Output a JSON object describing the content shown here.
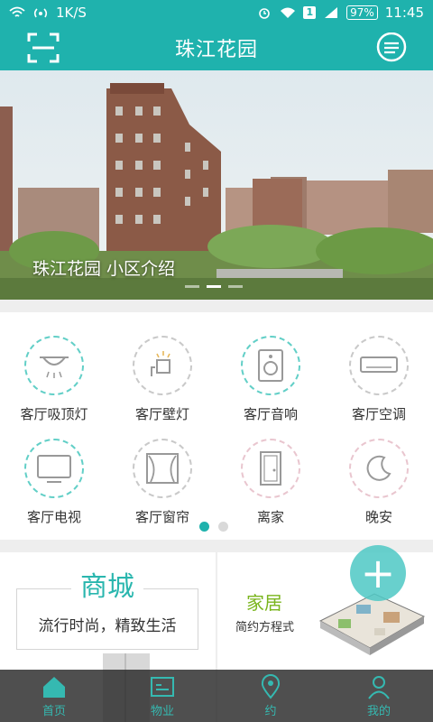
{
  "status_bar": {
    "net_speed": "1K/S",
    "sim_badge": "1",
    "battery": "97%",
    "time": "11:45"
  },
  "header": {
    "title": "珠江花园",
    "left_icon": "scan-icon",
    "right_icon": "message-icon"
  },
  "banner": {
    "caption": "珠江花园 小区介绍",
    "slides": 3,
    "active_slide": 1
  },
  "devices": [
    {
      "label": "客厅吸顶灯",
      "icon": "ceiling-light-icon"
    },
    {
      "label": "客厅壁灯",
      "icon": "wall-lamp-icon"
    },
    {
      "label": "客厅音响",
      "icon": "speaker-icon"
    },
    {
      "label": "客厅空调",
      "icon": "air-conditioner-icon"
    },
    {
      "label": "客厅电视",
      "icon": "tv-icon"
    },
    {
      "label": "客厅窗帘",
      "icon": "curtain-icon"
    },
    {
      "label": "离家",
      "icon": "door-icon"
    },
    {
      "label": "晚安",
      "icon": "moon-icon"
    }
  ],
  "device_pages": {
    "total": 2,
    "active": 1
  },
  "promos": {
    "mall": {
      "title": "商城",
      "subtitle": "流行时尚，精致生活"
    },
    "home": {
      "title": "家居",
      "subtitle": "简约方程式"
    }
  },
  "fab_label": "+",
  "tabs": [
    {
      "label": "首页",
      "icon": "home-icon"
    },
    {
      "label": "物业",
      "icon": "property-icon"
    },
    {
      "label": "约",
      "icon": "location-icon"
    },
    {
      "label": "我的",
      "icon": "user-icon"
    }
  ],
  "colors": {
    "accent": "#1fb2ad",
    "green": "#7ab51d"
  }
}
